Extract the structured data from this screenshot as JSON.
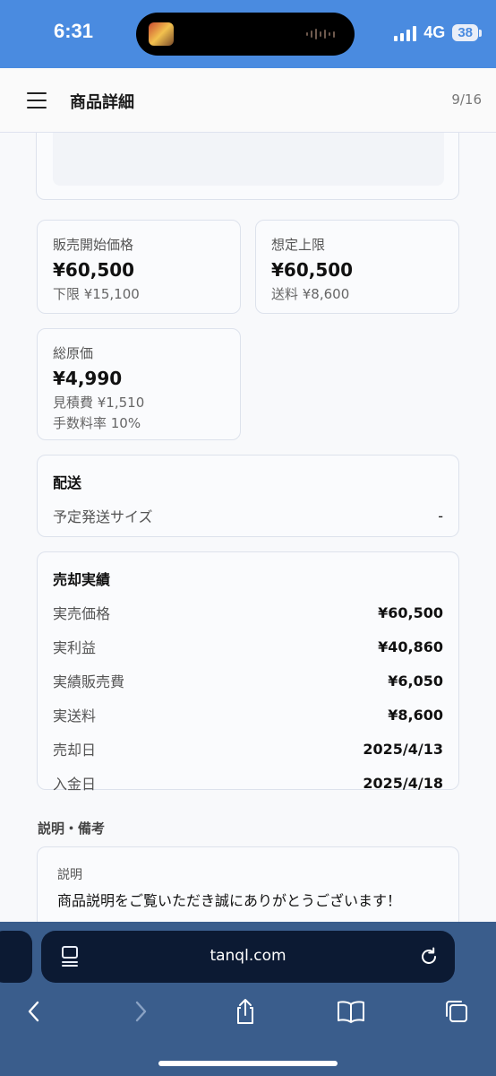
{
  "status": {
    "time": "6:31",
    "network": "4G",
    "battery": "38"
  },
  "header": {
    "title": "商品詳細",
    "page_counter": "9/16"
  },
  "metrics": {
    "start_price": {
      "label": "販売開始価格",
      "value": "¥60,500",
      "sub": "下限 ¥15,100"
    },
    "expected_max": {
      "label": "想定上限",
      "value": "¥60,500",
      "sub": "送料 ¥8,600"
    },
    "total_cost": {
      "label": "総原価",
      "value": "¥4,990",
      "sub1": "見積費 ¥1,510",
      "sub2": "手数料率 10%"
    }
  },
  "shipping": {
    "title": "配送",
    "rows": [
      {
        "label": "予定発送サイズ",
        "value": "-"
      }
    ]
  },
  "sales": {
    "title": "売却実績",
    "rows": [
      {
        "label": "実売価格",
        "value": "¥60,500"
      },
      {
        "label": "実利益",
        "value": "¥40,860"
      },
      {
        "label": "実績販売費",
        "value": "¥6,050"
      },
      {
        "label": "実送料",
        "value": "¥8,600"
      },
      {
        "label": "売却日",
        "value": "2025/4/13"
      },
      {
        "label": "入金日",
        "value": "2025/4/18"
      }
    ]
  },
  "notes": {
    "heading": "説明・備考",
    "description_label": "説明",
    "description_text": "商品説明をご覧いただき誠にありがとうございます！"
  },
  "browser": {
    "url": "tanql.com"
  },
  "icons": {
    "menu": "hamburger-icon",
    "tabs": "tab-overview-icon",
    "reload": "reload-icon",
    "back": "chevron-left-icon",
    "forward": "chevron-right-icon",
    "share": "share-icon",
    "bookmarks": "book-icon",
    "tab_switcher": "tabs-icon"
  },
  "colors": {
    "status_bar": "#4a8be0",
    "browser_bar": "#3a5d8c",
    "url_field": "#0c1a33"
  }
}
